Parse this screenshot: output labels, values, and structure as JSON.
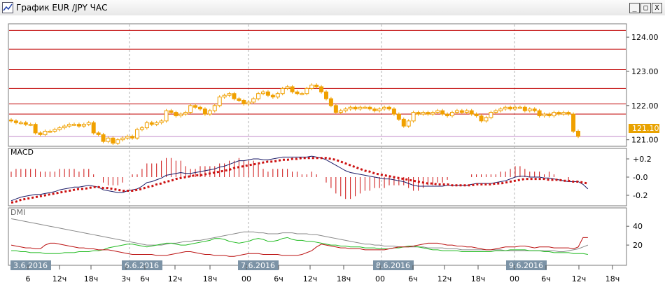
{
  "window": {
    "title": "График EUR /JPY ЧАС",
    "min_label": "_",
    "max_label": "□",
    "close_label": "X"
  },
  "panels": {
    "price": {
      "y_ticks": [
        "124.00",
        "123.00",
        "122.00",
        "121.00"
      ],
      "current_price": "121.10"
    },
    "macd": {
      "label": "MACD",
      "y_ticks": [
        "+0.2",
        "-0.0",
        "-0.2"
      ]
    },
    "dmi": {
      "label": "DMI",
      "y_ticks": [
        "40",
        "20"
      ]
    }
  },
  "x_axis": {
    "date_labels": [
      "3.6.2016",
      "6.6.2016",
      "7.6.2016",
      "8.6.2016",
      "9.6.2016"
    ],
    "hour_labels": [
      "6",
      "12ч",
      "18ч",
      "3ч",
      "6ч",
      "12ч",
      "18ч",
      "00",
      "6ч",
      "12ч",
      "18ч",
      "00",
      "6ч",
      "12ч",
      "18ч",
      "00",
      "6ч",
      "12ч",
      "18ч"
    ]
  },
  "colors": {
    "candle": "#f0a000",
    "macd_line": "#1a1a66",
    "signal": "#cc1111",
    "dmi_plus": "#22bb22",
    "dmi_minus": "#bb1111",
    "adx": "#888888",
    "resistance": "#c00000"
  },
  "chart_data": {
    "type": "candlestick",
    "resistance_levels": [
      124.2,
      123.65,
      123.05,
      122.5,
      122.05,
      121.75
    ],
    "price_ylim": [
      120.85,
      124.35
    ],
    "close": [
      121.55,
      121.5,
      121.5,
      121.45,
      121.45,
      121.2,
      121.15,
      121.25,
      121.25,
      121.3,
      121.35,
      121.4,
      121.45,
      121.45,
      121.4,
      121.45,
      121.5,
      121.2,
      121.15,
      120.95,
      121.05,
      120.9,
      121.0,
      121.05,
      121.1,
      121.05,
      121.3,
      121.35,
      121.5,
      121.45,
      121.5,
      121.55,
      121.85,
      121.8,
      121.7,
      121.75,
      121.8,
      122.0,
      121.95,
      121.9,
      121.75,
      121.85,
      122.0,
      122.25,
      122.3,
      122.35,
      122.2,
      122.15,
      122.05,
      122.1,
      122.2,
      122.35,
      122.4,
      122.3,
      122.25,
      122.35,
      122.5,
      122.55,
      122.4,
      122.35,
      122.35,
      122.5,
      122.6,
      122.55,
      122.4,
      122.2,
      122.0,
      121.8,
      121.85,
      121.9,
      121.95,
      121.9,
      121.95,
      121.95,
      121.9,
      121.85,
      121.9,
      121.95,
      121.9,
      121.75,
      121.6,
      121.4,
      121.55,
      121.8,
      121.75,
      121.8,
      121.75,
      121.8,
      121.85,
      121.75,
      121.7,
      121.8,
      121.85,
      121.8,
      121.85,
      121.75,
      121.7,
      121.55,
      121.65,
      121.8,
      121.85,
      121.9,
      121.95,
      121.9,
      121.95,
      121.95,
      121.85,
      121.9,
      121.85,
      121.7,
      121.75,
      121.7,
      121.8,
      121.75,
      121.8,
      121.75,
      121.25,
      121.1
    ],
    "macd_ylim": [
      -0.3,
      0.3
    ],
    "macd": [
      -0.26,
      -0.24,
      -0.22,
      -0.21,
      -0.2,
      -0.19,
      -0.19,
      -0.18,
      -0.17,
      -0.16,
      -0.14,
      -0.13,
      -0.12,
      -0.11,
      -0.11,
      -0.1,
      -0.09,
      -0.1,
      -0.11,
      -0.14,
      -0.15,
      -0.16,
      -0.17,
      -0.17,
      -0.15,
      -0.14,
      -0.13,
      -0.1,
      -0.06,
      -0.05,
      -0.03,
      -0.01,
      0.02,
      0.03,
      0.04,
      0.05,
      0.04,
      0.04,
      0.05,
      0.06,
      0.07,
      0.08,
      0.09,
      0.11,
      0.12,
      0.14,
      0.16,
      0.18,
      0.18,
      0.19,
      0.2,
      0.2,
      0.19,
      0.19,
      0.2,
      0.21,
      0.22,
      0.22,
      0.22,
      0.22,
      0.22,
      0.22,
      0.23,
      0.22,
      0.21,
      0.19,
      0.16,
      0.13,
      0.1,
      0.07,
      0.05,
      0.04,
      0.03,
      0.02,
      0.01,
      0.0,
      -0.01,
      -0.02,
      -0.02,
      -0.03,
      -0.04,
      -0.05,
      -0.07,
      -0.09,
      -0.1,
      -0.1,
      -0.1,
      -0.1,
      -0.1,
      -0.1,
      -0.09,
      -0.09,
      -0.09,
      -0.09,
      -0.09,
      -0.08,
      -0.07,
      -0.07,
      -0.07,
      -0.07,
      -0.06,
      -0.05,
      -0.04,
      -0.02,
      0.0,
      0.01,
      0.01,
      0.0,
      0.0,
      0.0,
      -0.01,
      -0.01,
      -0.02,
      -0.03,
      -0.04,
      -0.05,
      -0.05,
      -0.05,
      -0.08,
      -0.13
    ],
    "signal": [
      -0.28,
      -0.27,
      -0.25,
      -0.24,
      -0.23,
      -0.22,
      -0.21,
      -0.2,
      -0.19,
      -0.18,
      -0.17,
      -0.16,
      -0.15,
      -0.14,
      -0.13,
      -0.13,
      -0.12,
      -0.11,
      -0.11,
      -0.12,
      -0.12,
      -0.13,
      -0.14,
      -0.15,
      -0.15,
      -0.15,
      -0.14,
      -0.13,
      -0.11,
      -0.1,
      -0.08,
      -0.07,
      -0.05,
      -0.04,
      -0.02,
      -0.01,
      0.0,
      0.01,
      0.02,
      0.02,
      0.03,
      0.04,
      0.05,
      0.06,
      0.07,
      0.08,
      0.1,
      0.11,
      0.12,
      0.13,
      0.14,
      0.15,
      0.16,
      0.17,
      0.17,
      0.18,
      0.19,
      0.19,
      0.2,
      0.2,
      0.21,
      0.21,
      0.21,
      0.21,
      0.21,
      0.21,
      0.2,
      0.19,
      0.17,
      0.15,
      0.13,
      0.11,
      0.09,
      0.07,
      0.06,
      0.04,
      0.03,
      0.02,
      0.01,
      0.0,
      -0.01,
      -0.02,
      -0.03,
      -0.04,
      -0.05,
      -0.06,
      -0.07,
      -0.07,
      -0.08,
      -0.08,
      -0.08,
      -0.09,
      -0.09,
      -0.09,
      -0.09,
      -0.09,
      -0.08,
      -0.08,
      -0.08,
      -0.08,
      -0.07,
      -0.07,
      -0.06,
      -0.05,
      -0.04,
      -0.03,
      -0.02,
      -0.02,
      -0.02,
      -0.02,
      -0.02,
      -0.03,
      -0.03,
      -0.03,
      -0.04,
      -0.04,
      -0.05,
      -0.05,
      -0.06,
      -0.07
    ],
    "dmi_ylim": [
      0,
      58
    ],
    "adx": [
      48,
      47,
      46,
      45,
      44,
      43,
      42,
      41,
      40,
      39,
      38,
      37,
      36,
      35,
      34,
      33,
      32,
      31,
      30,
      29,
      28,
      27,
      26,
      25,
      24,
      23,
      22,
      21,
      20,
      20,
      20,
      20,
      21,
      22,
      22,
      23,
      24,
      24,
      25,
      25,
      26,
      27,
      28,
      29,
      30,
      31,
      32,
      33,
      34,
      34,
      34,
      33,
      33,
      32,
      32,
      32,
      33,
      33,
      33,
      32,
      32,
      32,
      31,
      31,
      30,
      29,
      28,
      27,
      26,
      25,
      24,
      23,
      22,
      21,
      21,
      20,
      20,
      19,
      19,
      19,
      18,
      18,
      18,
      18,
      18,
      18,
      17,
      17,
      17,
      17,
      16,
      16,
      16,
      15,
      15,
      15,
      15,
      15,
      15,
      15,
      15,
      15,
      14,
      14,
      14,
      14,
      14,
      14,
      14,
      14,
      14,
      14,
      14,
      13,
      13,
      14,
      15,
      16,
      18,
      20
    ],
    "dmi_plus": [
      14,
      14,
      13,
      13,
      12,
      12,
      12,
      11,
      11,
      11,
      11,
      12,
      12,
      12,
      13,
      13,
      13,
      14,
      14,
      15,
      17,
      18,
      19,
      20,
      21,
      21,
      20,
      19,
      18,
      19,
      20,
      21,
      22,
      22,
      21,
      20,
      20,
      21,
      22,
      23,
      24,
      25,
      27,
      27,
      26,
      24,
      23,
      22,
      23,
      24,
      26,
      27,
      26,
      24,
      24,
      25,
      27,
      28,
      26,
      25,
      25,
      24,
      24,
      23,
      22,
      21,
      20,
      20,
      19,
      19,
      18,
      18,
      18,
      17,
      17,
      17,
      16,
      16,
      16,
      17,
      17,
      18,
      19,
      19,
      18,
      17,
      16,
      15,
      15,
      14,
      14,
      14,
      14,
      13,
      13,
      13,
      13,
      13,
      13,
      13,
      14,
      14,
      14,
      15,
      15,
      15,
      15,
      14,
      14,
      14,
      13,
      13,
      12,
      12,
      12,
      12,
      11,
      11,
      11,
      10
    ],
    "dmi_minus": [
      20,
      19,
      18,
      17,
      17,
      16,
      16,
      20,
      22,
      22,
      21,
      20,
      19,
      18,
      17,
      17,
      16,
      16,
      15,
      15,
      15,
      14,
      13,
      12,
      11,
      10,
      10,
      10,
      10,
      10,
      9,
      9,
      9,
      10,
      11,
      12,
      13,
      13,
      12,
      11,
      10,
      10,
      9,
      9,
      9,
      8,
      8,
      9,
      10,
      11,
      11,
      11,
      10,
      10,
      10,
      10,
      9,
      9,
      9,
      9,
      10,
      12,
      14,
      18,
      21,
      20,
      19,
      18,
      17,
      17,
      16,
      16,
      16,
      15,
      15,
      15,
      15,
      15,
      16,
      17,
      18,
      18,
      18,
      19,
      20,
      21,
      22,
      22,
      22,
      21,
      20,
      20,
      19,
      19,
      18,
      18,
      17,
      16,
      15,
      15,
      16,
      17,
      18,
      18,
      18,
      19,
      19,
      18,
      17,
      18,
      18,
      18,
      17,
      17,
      17,
      17,
      16,
      18,
      28,
      28
    ]
  }
}
